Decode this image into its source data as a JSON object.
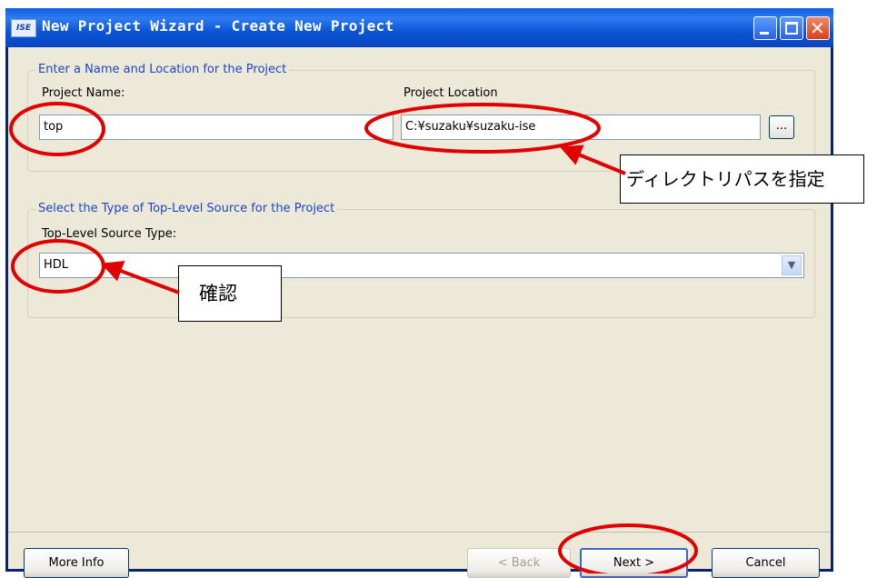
{
  "window": {
    "title": "New Project Wizard - Create New Project",
    "app_icon_text": "ISE"
  },
  "group1": {
    "title": "Enter a Name and Location for the Project",
    "name_label": "Project Name:",
    "name_value": "top",
    "location_label": "Project Location",
    "location_value": "C:¥suzaku¥suzaku-ise",
    "browse_label": "..."
  },
  "group2": {
    "title": "Select the Type of Top-Level Source for the Project",
    "source_label": "Top-Level Source Type:",
    "source_value": "HDL"
  },
  "buttons": {
    "more_info": "More Info",
    "back": "< Back",
    "next": "Next >",
    "cancel": "Cancel"
  },
  "annotations": {
    "path_note": "ディレクトリパスを指定",
    "confirm_note": "確認"
  },
  "colors": {
    "highlight": "#e00000",
    "titlebar": "#0b55d6",
    "group_title": "#1f45c6"
  }
}
